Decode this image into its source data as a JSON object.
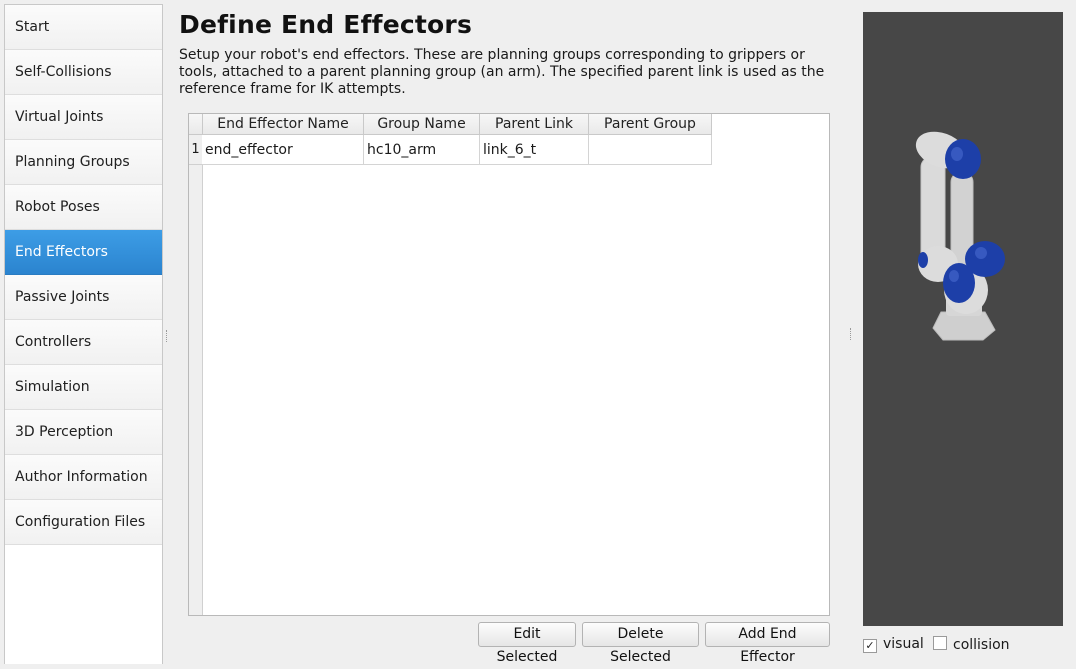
{
  "sidebar": {
    "items": [
      {
        "label": "Start"
      },
      {
        "label": "Self-Collisions"
      },
      {
        "label": "Virtual Joints"
      },
      {
        "label": "Planning Groups"
      },
      {
        "label": "Robot Poses"
      },
      {
        "label": "End Effectors",
        "active": true
      },
      {
        "label": "Passive Joints"
      },
      {
        "label": "Controllers"
      },
      {
        "label": "Simulation"
      },
      {
        "label": "3D Perception"
      },
      {
        "label": "Author Information"
      },
      {
        "label": "Configuration Files"
      }
    ]
  },
  "main": {
    "title": "Define End Effectors",
    "description": "Setup your robot's end effectors. These are planning groups corresponding to grippers or tools, attached to a parent planning group (an arm). The specified parent link is used as the reference frame for IK attempts.",
    "table": {
      "headers": [
        "End Effector Name",
        "Group Name",
        "Parent Link",
        "Parent Group"
      ],
      "rows": [
        {
          "num": "1",
          "cells": [
            "end_effector",
            "hc10_arm",
            "link_6_t",
            ""
          ]
        }
      ]
    },
    "buttons": {
      "edit": "Edit Selected",
      "delete": "Delete Selected",
      "add": "Add End Effector"
    }
  },
  "viewer": {
    "visual_label": "visual",
    "visual_checked": true,
    "collision_label": "collision",
    "collision_checked": false,
    "check_mark": "✓"
  },
  "colors": {
    "accent": "#2b84cf",
    "viewer_bg": "#474747",
    "robot_body": "#dcdcdc",
    "robot_cap": "#1d3fa8"
  }
}
